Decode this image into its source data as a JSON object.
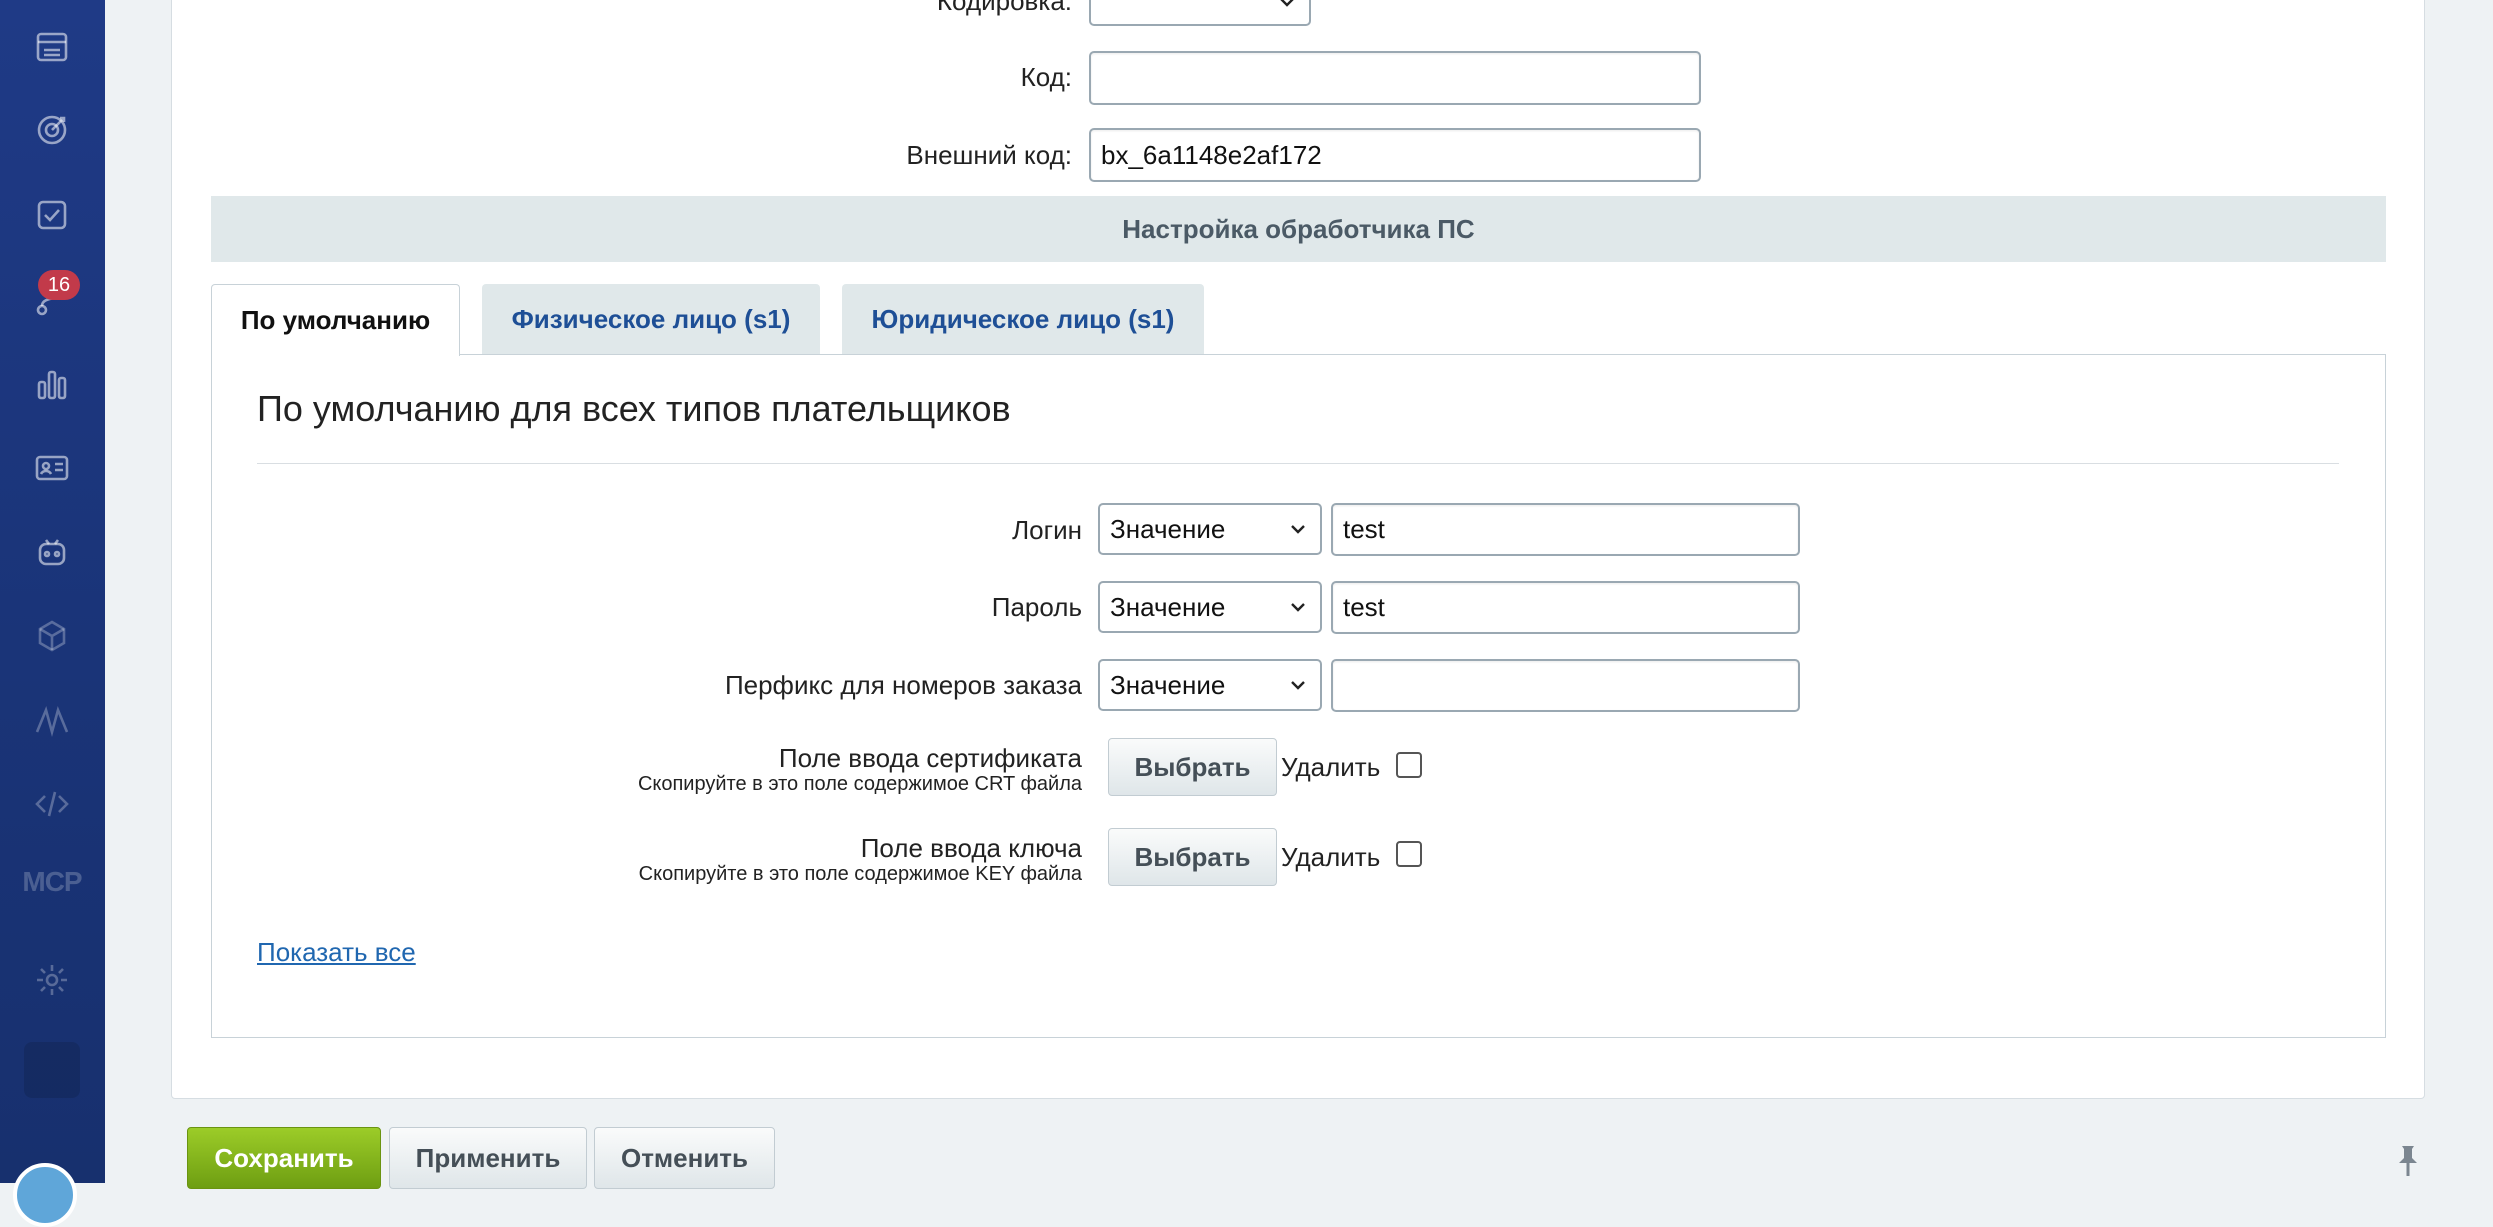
{
  "form": {
    "encoding_label": "Кодировка:",
    "code_label": "Код:",
    "code_value": "",
    "external_code_label": "Внешний код:",
    "external_code_value": "bx_6a1148e2af172"
  },
  "section_header": "Настройка обработчика ПС",
  "tabs": [
    {
      "label": "По умолчанию",
      "active": true
    },
    {
      "label": "Физическое лицо (s1)",
      "active": false
    },
    {
      "label": "Юридическое лицо (s1)",
      "active": false
    }
  ],
  "content": {
    "title": "По умолчанию для всех типов плательщиков",
    "fields": [
      {
        "label": "Логин",
        "type_value": "Значение",
        "value": "test"
      },
      {
        "label": "Пароль",
        "type_value": "Значение",
        "value": "test"
      },
      {
        "label": "Перфикс для номеров заказа",
        "type_value": "Значение",
        "value": ""
      }
    ],
    "file_fields": [
      {
        "label": "Поле ввода сертификата",
        "hint": "Скопируйте в это поле содержимое CRT файла",
        "button": "Выбрать",
        "delete_label": "Удалить"
      },
      {
        "label": "Поле ввода ключа",
        "hint": "Скопируйте в это поле содержимое KEY файла",
        "button": "Выбрать",
        "delete_label": "Удалить"
      }
    ],
    "show_all_link": "Показать все"
  },
  "footer": {
    "save": "Сохранить",
    "apply": "Применить",
    "cancel": "Отменить"
  },
  "sidebar": {
    "badge_count": "16",
    "mcp_label": "MCP",
    "icons": [
      "store-icon",
      "target-icon",
      "task-check-icon",
      "flow-icon",
      "bar-chart-icon",
      "contact-card-icon",
      "robot-icon",
      "cube-icon",
      "signature-icon",
      "code-icon",
      "gear-icon"
    ]
  },
  "colors": {
    "sidebar": "#1f3a86",
    "accent_green": "#7fb41c",
    "link_blue": "#2067b0",
    "section_bg": "#e0e8ea"
  }
}
